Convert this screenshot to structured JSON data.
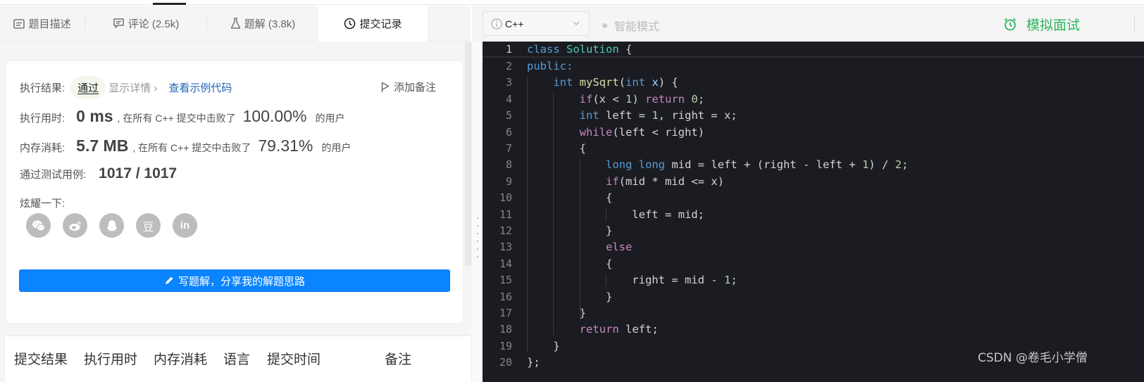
{
  "left_tabs": [
    {
      "label": "题目描述",
      "icon": "description-icon"
    },
    {
      "label": "评论 (2.5k)",
      "icon": "comment-icon"
    },
    {
      "label": "题解 (3.8k)",
      "icon": "flask-icon"
    },
    {
      "label": "提交记录",
      "icon": "clock-icon",
      "active": true
    }
  ],
  "result": {
    "exec_result_label": "执行结果:",
    "status": "通过",
    "show_detail": "显示详情 ›",
    "view_sample_code": "查看示例代码",
    "add_note": "添加备注",
    "runtime_label": "执行用时:",
    "runtime_value": "0 ms",
    "runtime_mid": ", 在所有 C++ 提交中击败了",
    "runtime_percent": "100.00%",
    "runtime_suffix": "的用户",
    "memory_label": "内存消耗:",
    "memory_value": "5.7 MB",
    "memory_mid": ", 在所有 C++ 提交中击败了",
    "memory_percent": "79.31%",
    "memory_suffix": "的用户",
    "testcases_label": "通过测试用例:",
    "testcases_value": "1017 / 1017",
    "share_label": "炫耀一下:",
    "share_icons": [
      {
        "name": "wechat",
        "glyph": "💬"
      },
      {
        "name": "weibo",
        "glyph": "◎"
      },
      {
        "name": "qq",
        "glyph": "♟"
      },
      {
        "name": "douban",
        "glyph": "豆"
      },
      {
        "name": "linkedin",
        "glyph": "in"
      }
    ],
    "write_solution_button": "写题解，分享我的解题思路"
  },
  "history": {
    "columns": [
      "提交结果",
      "执行用时",
      "内存消耗",
      "语言",
      "提交时间",
      "备注"
    ]
  },
  "editor_header": {
    "language": "C++",
    "smart_mode": "智能模式",
    "mock_interview": "模拟面试"
  },
  "code": {
    "language": "cpp",
    "lines": [
      "class Solution {",
      "public:",
      "    int mySqrt(int x) {",
      "        if(x < 1) return 0;",
      "        int left = 1, right = x;",
      "        while(left < right)",
      "        {",
      "            long long mid = left + (right - left + 1) / 2;",
      "            if(mid * mid <= x)",
      "            {",
      "                left = mid;",
      "            }",
      "            else",
      "            {",
      "                right = mid - 1;",
      "            }",
      "        }",
      "        return left;",
      "    }",
      "};"
    ]
  },
  "watermark": "CSDN @卷毛小学僧"
}
